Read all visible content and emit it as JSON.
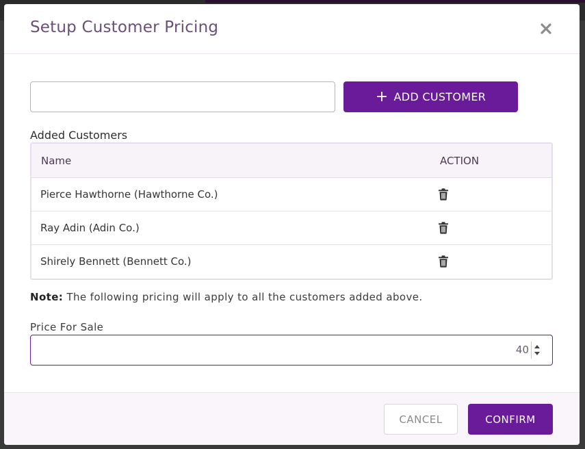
{
  "dialog": {
    "title": "Setup Customer Pricing",
    "close_icon": "close-icon"
  },
  "search": {
    "value": "",
    "placeholder": ""
  },
  "add_button": {
    "icon": "plus-icon",
    "label": "ADD CUSTOMER"
  },
  "customers": {
    "section_label": "Added Customers",
    "columns": [
      "Name",
      "ACTION"
    ],
    "rows": [
      {
        "name": "Pierce Hawthorne (Hawthorne Co.)",
        "action_icon": "trash-icon"
      },
      {
        "name": "Ray Adin (Adin Co.)",
        "action_icon": "trash-icon"
      },
      {
        "name": "Shirely Bennett (Bennett Co.)",
        "action_icon": "trash-icon"
      }
    ]
  },
  "note": {
    "prefix": "Note:",
    "text": "The following pricing will apply to all the customers added above."
  },
  "price": {
    "label": "Price For Sale",
    "value": "40"
  },
  "footer": {
    "cancel_label": "CANCEL",
    "confirm_label": "CONFIRM"
  },
  "colors": {
    "accent": "#6a1b9a",
    "title": "#6b4f79",
    "header_bg": "#f8f3f9",
    "footer_bg": "#faf5fb"
  }
}
